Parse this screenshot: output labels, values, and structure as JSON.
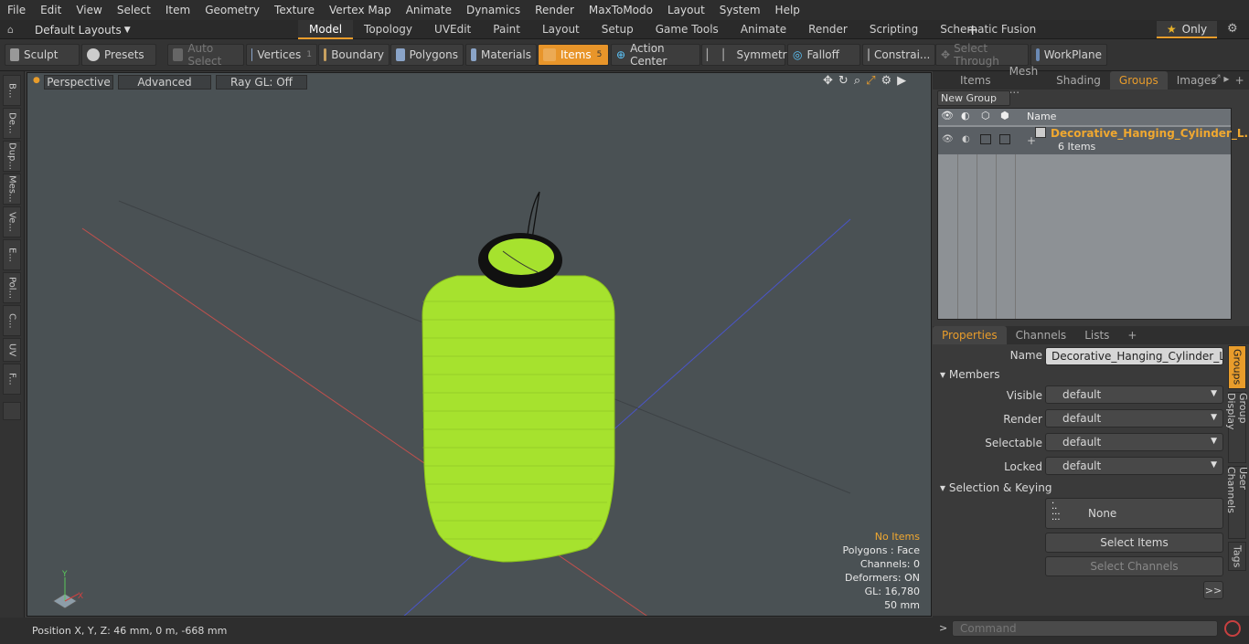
{
  "menu": [
    "File",
    "Edit",
    "View",
    "Select",
    "Item",
    "Geometry",
    "Texture",
    "Vertex Map",
    "Animate",
    "Dynamics",
    "Render",
    "MaxToModo",
    "Layout",
    "System",
    "Help"
  ],
  "layout_selector": "Default Layouts",
  "mode_tabs": [
    "Model",
    "Topology",
    "UVEdit",
    "Paint",
    "Layout",
    "Setup",
    "Game Tools",
    "Animate",
    "Render",
    "Scripting",
    "Schematic Fusion"
  ],
  "active_mode_tab": "Model",
  "only_button": "Only",
  "toolbar": {
    "sculpt": "Sculpt",
    "presets": "Presets",
    "auto_select": "Auto Select",
    "vertices": "Vertices",
    "vertices_count": "1",
    "boundary": "Boundary",
    "polygons": "Polygons",
    "materials": "Materials",
    "items": "Items",
    "items_count": "5",
    "action_center": "Action Center",
    "symmetry": "Symmetry",
    "falloff": "Falloff",
    "constraints": "Constrai...",
    "select_through": "Select Through",
    "workplane": "WorkPlane"
  },
  "left_tabs": [
    "B...",
    "De...",
    "Dup...",
    "Mes...",
    "Ve...",
    "E...",
    "Pol...",
    "C...",
    "UV",
    "F..."
  ],
  "viewport": {
    "view_mode": "Perspective",
    "shading": "Advanced",
    "raygl": "Ray GL: Off",
    "info": {
      "items": "No Items",
      "polygons": "Polygons : Face",
      "channels": "Channels: 0",
      "deformers": "Deformers: ON",
      "gl": "GL: 16,780",
      "scale": "50 mm"
    },
    "axis_labels": {
      "y": "Y",
      "x": "X"
    }
  },
  "status": {
    "position": "Position X, Y, Z:  46 mm, 0 m, -668 mm"
  },
  "top_right_tabs": [
    "Items",
    "Mesh ...",
    "Shading",
    "Groups",
    "Images"
  ],
  "active_top_right_tab": "Groups",
  "new_group": "New Group",
  "group_list": {
    "name_header": "Name",
    "group_name": "Decorative_Hanging_Cylinder_L...",
    "group_count": "6 Items"
  },
  "bottom_tabs": [
    "Properties",
    "Channels",
    "Lists"
  ],
  "active_bottom_tab": "Properties",
  "properties": {
    "name_label": "Name",
    "name_value": "Decorative_Hanging_Cylinder_Lantern",
    "members_section": "Members",
    "visible_label": "Visible",
    "visible_value": "default",
    "render_label": "Render",
    "render_value": "default",
    "selectable_label": "Selectable",
    "selectable_value": "default",
    "locked_label": "Locked",
    "locked_value": "default",
    "selection_section": "Selection & Keying",
    "none_label": "None",
    "select_items": "Select Items",
    "select_channels": "Select Channels",
    "more": ">>"
  },
  "side_vtabs": [
    "Groups",
    "Group Display",
    "User Channels",
    "Tags"
  ],
  "command_placeholder": "Command",
  "colors": {
    "accent": "#e89c2b",
    "lantern": "#a6e22e",
    "viewport_bg": "#4a5154"
  }
}
